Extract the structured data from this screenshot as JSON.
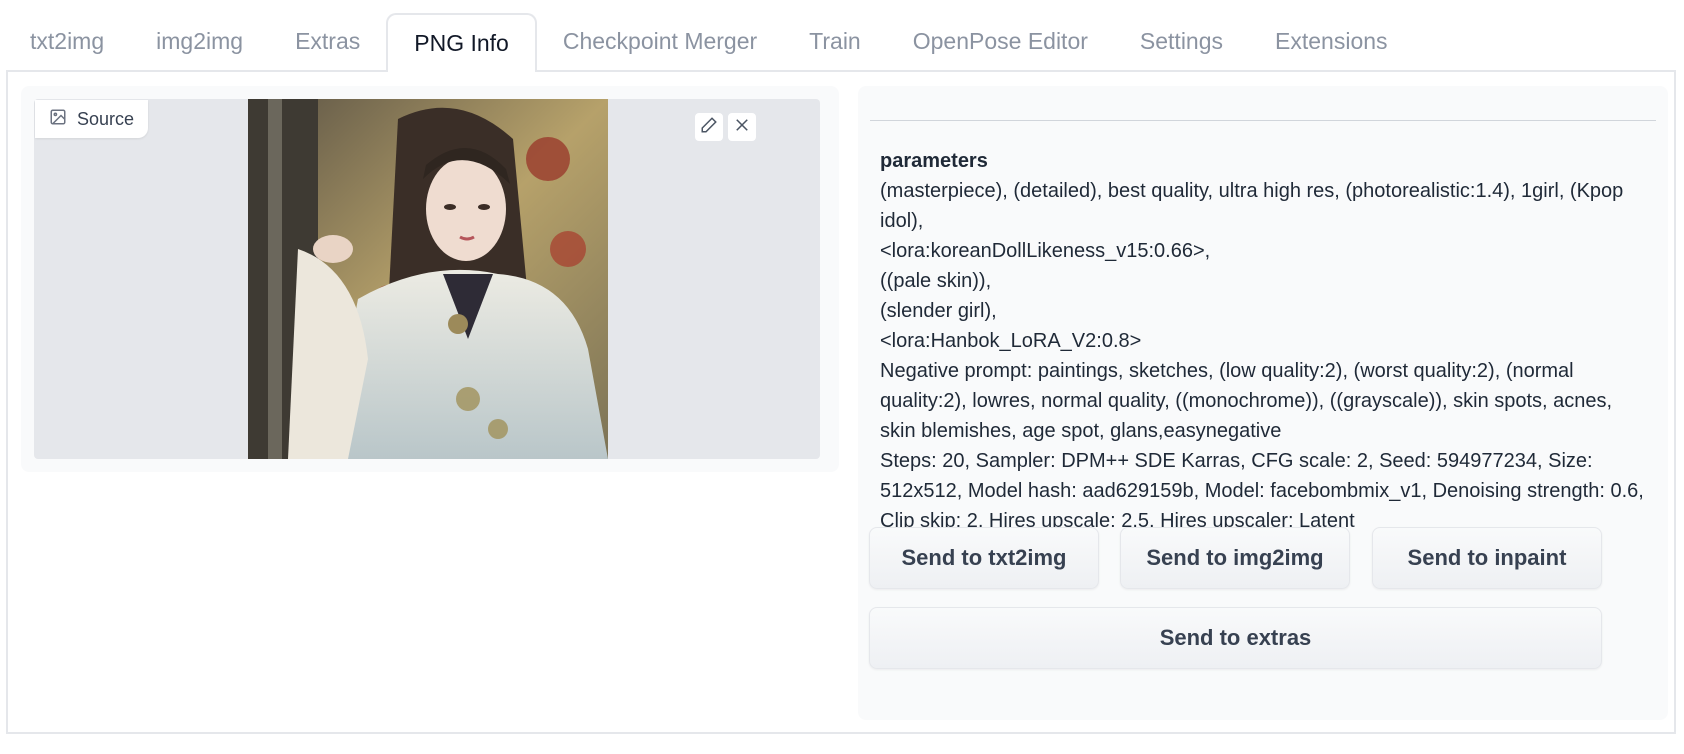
{
  "tabs": [
    {
      "label": "txt2img",
      "active": false
    },
    {
      "label": "img2img",
      "active": false
    },
    {
      "label": "Extras",
      "active": false
    },
    {
      "label": "PNG Info",
      "active": true
    },
    {
      "label": "Checkpoint Merger",
      "active": false
    },
    {
      "label": "Train",
      "active": false
    },
    {
      "label": "OpenPose Editor",
      "active": false
    },
    {
      "label": "Settings",
      "active": false
    },
    {
      "label": "Extensions",
      "active": false
    }
  ],
  "source": {
    "label": "Source",
    "icon": "image-icon",
    "edit_icon": "pencil-icon",
    "close_icon": "close-icon"
  },
  "info": {
    "heading": "parameters",
    "lines": [
      "(masterpiece), (detailed), best quality, ultra high res, (photorealistic:1.4), 1girl, (Kpop idol),",
      "<lora:koreanDollLikeness_v15:0.66>,",
      "((pale skin)),",
      "(slender girl),",
      "<lora:Hanbok_LoRA_V2:0.8>",
      "Negative prompt: paintings, sketches, (low quality:2), (worst quality:2), (normal quality:2), lowres, normal quality, ((monochrome)), ((grayscale)), skin spots, acnes, skin blemishes, age spot, glans,easynegative",
      "Steps: 20, Sampler: DPM++ SDE Karras, CFG scale: 2, Seed: 594977234, Size: 512x512, Model hash: aad629159b, Model: facebombmix_v1, Denoising strength: 0.6, Clip skip: 2, Hires upscale: 2.5, Hires upscaler: Latent"
    ]
  },
  "buttons": {
    "send_txt2img": "Send to txt2img",
    "send_img2img": "Send to img2img",
    "send_inpaint": "Send to inpaint",
    "send_extras": "Send to extras"
  }
}
